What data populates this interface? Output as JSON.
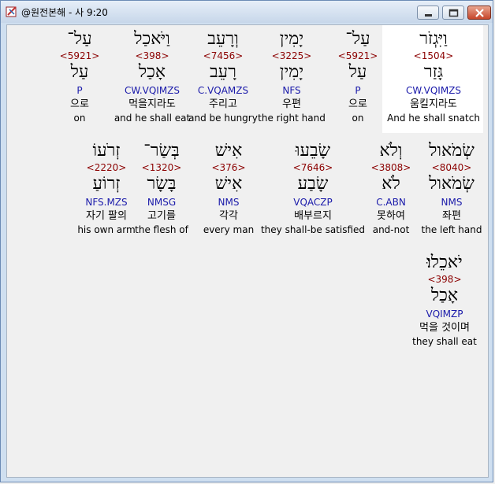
{
  "window": {
    "title": "@원전본해 - 사 9:20",
    "icon": "bible-app-icon"
  },
  "verse": {
    "rows": [
      [
        {
          "hebrew": "וַיִּגְזֹר",
          "strong": "<1504>",
          "lemma": "גָּזַר",
          "morph": "CW.VQIMZS",
          "korean": "움킬지라도",
          "english": "And he shall snatch",
          "highlight": true
        },
        {
          "hebrew": "עַל־",
          "strong": "<5921>",
          "lemma": "עַל",
          "morph": "P",
          "korean": "으로",
          "english": "on"
        },
        {
          "hebrew": "יָמִין",
          "strong": "<3225>",
          "lemma": "יָמִין",
          "morph": "NFS",
          "korean": "우편",
          "english": "the right hand"
        },
        {
          "hebrew": "וְרָעֵב",
          "strong": "<7456>",
          "lemma": "רָעֵב",
          "morph": "C.VQAMZS",
          "korean": "주리고",
          "english": "and be hungry"
        },
        {
          "hebrew": "וַיֹּאכַל",
          "strong": "<398>",
          "lemma": "אָכַל",
          "morph": "CW.VQIMZS",
          "korean": "먹을지라도",
          "english": "and he shall eat"
        },
        {
          "hebrew": "עַל־",
          "strong": "<5921>",
          "lemma": "עַל",
          "morph": "P",
          "korean": "으로",
          "english": "on"
        }
      ],
      [
        {
          "hebrew": "שְׂמֹאול",
          "strong": "<8040>",
          "lemma": "שְׂמֹאול",
          "morph": "NMS",
          "korean": "좌편",
          "english": "the left hand"
        },
        {
          "hebrew": "וְלֹא",
          "strong": "<3808>",
          "lemma": "לֹא",
          "morph": "C.ABN",
          "korean": "못하여",
          "english": "and-not"
        },
        {
          "hebrew": "שָׂבֵעוּ",
          "strong": "<7646>",
          "lemma": "שָׂבַע",
          "morph": "VQACZP",
          "korean": "배부르지",
          "english": "they shall-be satisfied"
        },
        {
          "hebrew": "אִישׁ",
          "strong": "<376>",
          "lemma": "אִישׁ",
          "morph": "NMS",
          "korean": "각각",
          "english": "every man"
        },
        {
          "hebrew": "בְּשַׂר־",
          "strong": "<1320>",
          "lemma": "בָּשָׂר",
          "morph": "NMSG",
          "korean": "고기를",
          "english": "the flesh of"
        },
        {
          "hebrew": "זְרֹעוֹ",
          "strong": "<2220>",
          "lemma": "זְרוֹעַ",
          "morph": "NFS.MZS",
          "korean": "자기 팔의",
          "english": "his own arm"
        }
      ],
      [
        {
          "hebrew": "יֹאכֵלוּ׃",
          "strong": "<398>",
          "lemma": "אָכַל",
          "morph": "VQIMZP",
          "korean": "먹을 것이며",
          "english": "they shall eat"
        }
      ]
    ]
  }
}
